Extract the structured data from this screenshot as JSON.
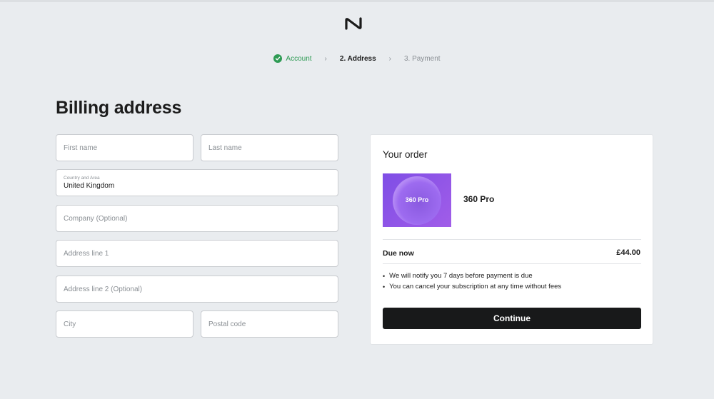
{
  "brand": {
    "logo_icon": "nothing-logo-icon"
  },
  "steps": [
    {
      "label": "Account",
      "state": "done",
      "icon": "check-circle-icon"
    },
    {
      "label": "2. Address",
      "state": "current"
    },
    {
      "label": "3. Payment",
      "state": "next"
    }
  ],
  "form": {
    "title": "Billing address",
    "first_name": {
      "placeholder": "First name"
    },
    "last_name": {
      "placeholder": "Last name"
    },
    "country": {
      "label": "Country and Area",
      "value": "United Kingdom"
    },
    "company": {
      "placeholder": "Company (Optional)"
    },
    "address1": {
      "placeholder": "Address line 1"
    },
    "address2": {
      "placeholder": "Address line 2 (Optional)"
    },
    "city": {
      "placeholder": "City"
    },
    "postal": {
      "placeholder": "Postal code"
    }
  },
  "order": {
    "title": "Your order",
    "product_image_text": "360 Pro",
    "product_name": "360 Pro",
    "due_label": "Due now",
    "due_amount": "£44.00",
    "notes": [
      "We will notify you 7 days before payment is due",
      "You can cancel your subscription at any time without fees"
    ],
    "continue_label": "Continue"
  },
  "colors": {
    "accent_green": "#2e9b54",
    "button_dark": "#18191a",
    "background": "#e9ecef"
  }
}
